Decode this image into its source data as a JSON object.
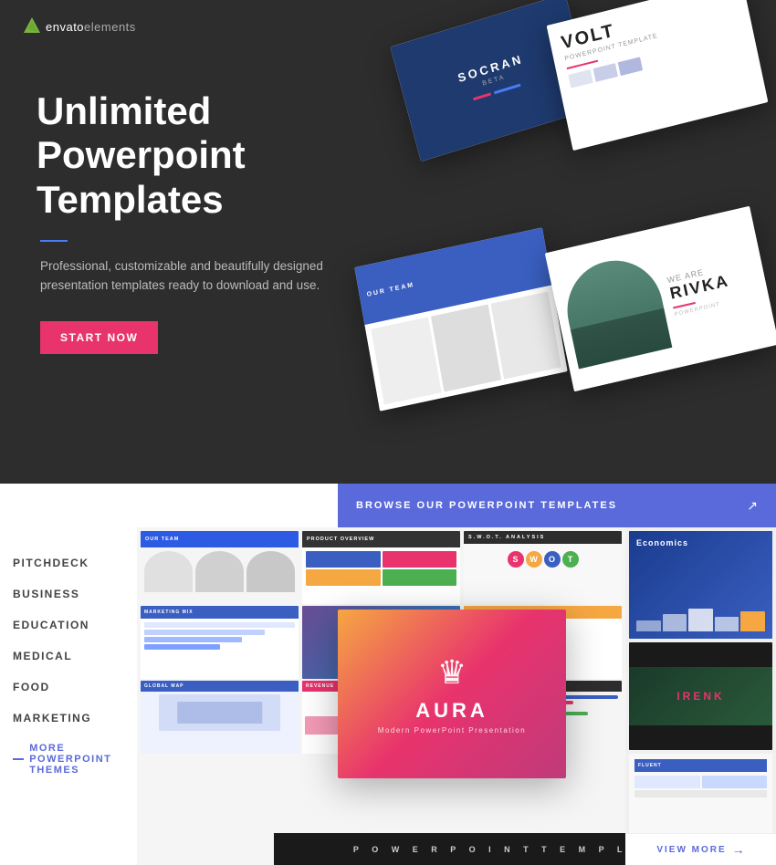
{
  "logo": {
    "icon_label": "envato-leaf-icon",
    "text_bold": "envato",
    "text_light": "elements"
  },
  "hero": {
    "title": "Unlimited Powerpoint Templates",
    "subtitle": "Professional, customizable and beautifully designed presentation templates ready to download and use.",
    "cta_label": "START NOW",
    "bg_color": "#2d2d2d"
  },
  "browse": {
    "header_text": "BROWSE OUR POWERPOINT TEMPLATES",
    "header_color": "#5a6adb"
  },
  "sidebar": {
    "items": [
      {
        "label": "PITCHDECK"
      },
      {
        "label": "BUSINESS"
      },
      {
        "label": "EDUCATION"
      },
      {
        "label": "MEDICAL"
      },
      {
        "label": "FOOD"
      },
      {
        "label": "MARKETING"
      }
    ],
    "more_label": "MORE POWERPOINT THEMES"
  },
  "featured": {
    "name": "AURA",
    "subtitle": "Modern PowerPoint Presentation",
    "gradient_start": "#f5a742",
    "gradient_end": "#c03a7a"
  },
  "ppt_bar": {
    "text": "P O W E R P O I N T   T E M P L A T E"
  },
  "right_thumbs": [
    {
      "label": "Economics",
      "bg": "#1a3c8f"
    },
    {
      "label": "IRENK",
      "bg": "#1a1a1a"
    },
    {
      "label": "FLUENT PRESENTATION",
      "bg": "#f8f8f8"
    }
  ],
  "view_more": {
    "label": "VIEW MORE"
  }
}
